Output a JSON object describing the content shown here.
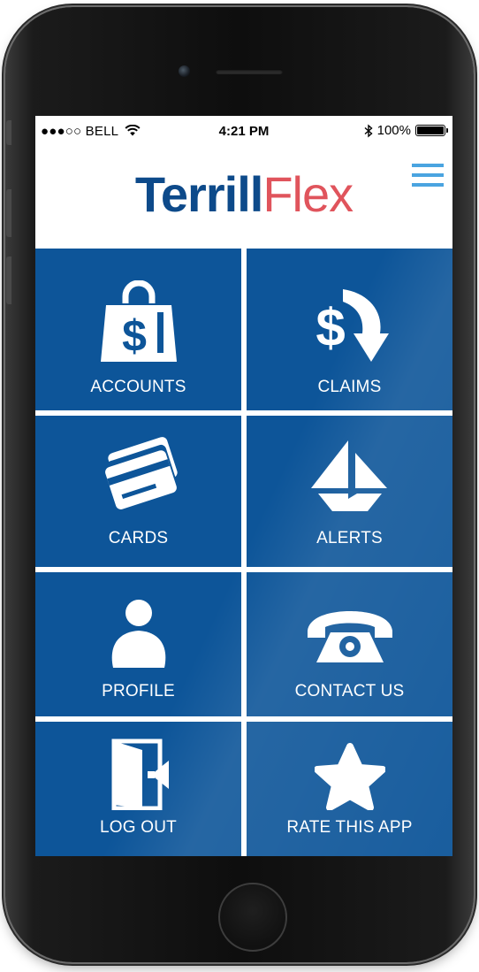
{
  "status_bar": {
    "carrier": "●●●○○ BELL",
    "time": "4:21 PM",
    "battery": "100%"
  },
  "brand": {
    "part1": "Terrill",
    "part2": "Flex"
  },
  "menu": {
    "icon": "hamburger-icon"
  },
  "tiles": [
    {
      "label": "ACCOUNTS",
      "icon": "shopping-bag-dollar-icon"
    },
    {
      "label": "CLAIMS",
      "icon": "dollar-arrow-icon"
    },
    {
      "label": "CARDS",
      "icon": "credit-cards-icon"
    },
    {
      "label": "ALERTS",
      "icon": "paper-boat-icon"
    },
    {
      "label": "PROFILE",
      "icon": "person-icon"
    },
    {
      "label": "CONTACT US",
      "icon": "telephone-icon"
    },
    {
      "label": "LOG OUT",
      "icon": "door-exit-icon"
    },
    {
      "label": "RATE THIS APP",
      "icon": "star-icon"
    }
  ],
  "colors": {
    "tile": "#0d5599",
    "brand_blue": "#0d4a8a",
    "brand_red": "#e0545c",
    "menu": "#4aa4e0"
  }
}
